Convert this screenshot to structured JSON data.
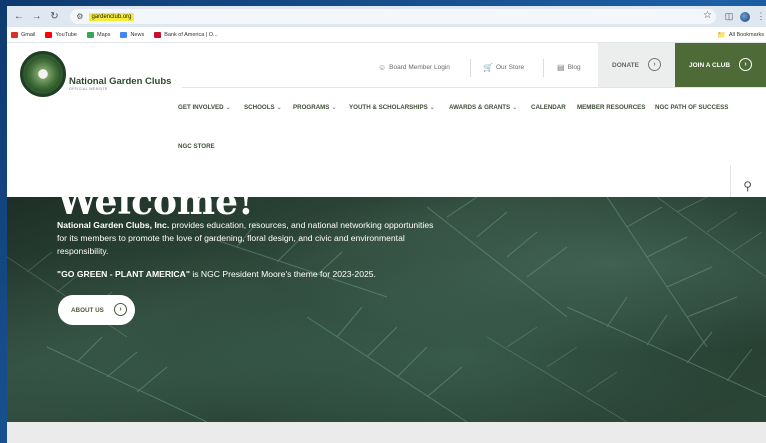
{
  "browser": {
    "url": "gardenclub.org",
    "bookmarks": [
      {
        "label": "Gmail",
        "color": "#d93025"
      },
      {
        "label": "YouTube",
        "color": "#ff0000"
      },
      {
        "label": "Maps",
        "color": "#34a853"
      },
      {
        "label": "News",
        "color": "#4285f4"
      },
      {
        "label": "Bank of America | O...",
        "color": "#c8102e"
      }
    ],
    "all_bookmarks": "All Bookmarks"
  },
  "site": {
    "logo_name": "National Garden Clubs",
    "logo_sub": "OFFICIAL WEBSITE",
    "utility": {
      "board_login": "Board Member Login",
      "our_store": "Our Store",
      "blog": "Blog",
      "donate": "DONATE",
      "join": "JOIN A CLUB"
    },
    "nav": {
      "get_involved": "GET INVOLVED",
      "schools": "SCHOOLS",
      "programs": "PROGRAMS",
      "youth": "YOUTH & SCHOLARSHIPS",
      "awards": "AWARDS & GRANTS",
      "calendar": "CALENDAR",
      "member_resources": "MEMBER RESOURCES",
      "path": "NGC PATH OF SUCCESS",
      "store": "NGC STORE"
    },
    "colors": {
      "brand_green": "#4e6b37",
      "logo_text": "#2c4a2b"
    }
  },
  "hero": {
    "welcome": "Welcome!",
    "org_bold": "National Garden Clubs, Inc.",
    "intro_rest": "provides education, resources, and national networking opportunities for its members to promote the love of gardening, floral design, and civic and environmental responsibility.",
    "theme_bold": "\"GO GREEN - PLANT AMERICA\"",
    "theme_rest": "is NGC President Moore's theme for 2023-2025.",
    "about_btn": "ABOUT US"
  }
}
